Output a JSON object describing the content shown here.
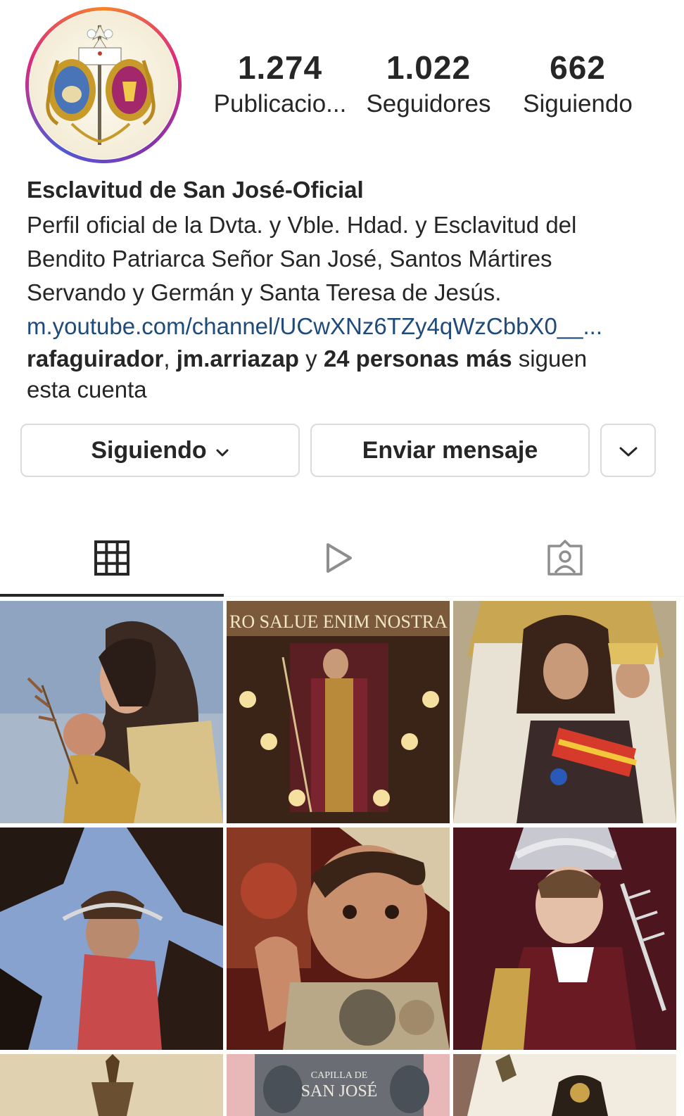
{
  "profile": {
    "stats": {
      "posts_value": "1.274",
      "posts_label": "Publicacio...",
      "followers_value": "1.022",
      "followers_label": "Seguidores",
      "following_value": "662",
      "following_label": "Siguiendo"
    },
    "name": "Esclavitud de San José-Oficial",
    "bio_lines": [
      "Perfil oficial de la Dvta. y Vble. Hdad. y Esclavitud del",
      "Bendito Patriarca Señor San José, Santos Mártires",
      "Servando y Germán y Santa Teresa de Jesús."
    ],
    "link": "m.youtube.com/channel/UCwXNz6TZy4qWzCbbX0__...",
    "followed_by": {
      "user1": "rafaguirador",
      "separator": ", ",
      "user2": "jm.arriazap",
      "conjunction": " y ",
      "others": "24 personas más",
      "suffix_line1": " siguen",
      "suffix_line2": "esta cuenta"
    }
  },
  "actions": {
    "following_label": "Siguiendo",
    "message_label": "Enviar mensaje"
  },
  "tabs": [
    {
      "icon": "grid-icon",
      "active": true
    },
    {
      "icon": "reels-icon",
      "active": false
    },
    {
      "icon": "tagged-icon",
      "active": false
    }
  ],
  "posts": [
    {
      "icon": "post-image"
    },
    {
      "icon": "post-image",
      "caption": "RO SALUE ENIM NOSTRA MISI"
    },
    {
      "icon": "post-image"
    },
    {
      "icon": "post-image"
    },
    {
      "icon": "post-image"
    },
    {
      "icon": "post-image"
    },
    {
      "icon": "post-image"
    },
    {
      "icon": "post-image",
      "caption": "CAPILLA DE SAN JOSÉ"
    },
    {
      "icon": "post-image"
    }
  ],
  "colors": {
    "text": "#262626",
    "link": "#1f4b7b",
    "border": "#dbdbdb",
    "icon_inactive": "#8e8e8e"
  }
}
